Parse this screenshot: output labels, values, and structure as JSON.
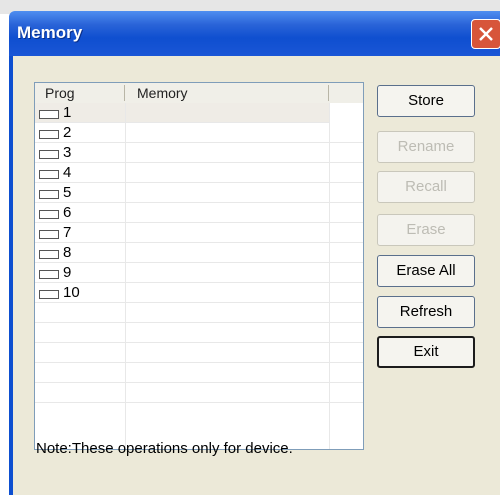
{
  "window": {
    "title": "Memory"
  },
  "list": {
    "columns": [
      "Prog",
      "Memory"
    ],
    "rows": [
      "1",
      "2",
      "3",
      "4",
      "5",
      "6",
      "7",
      "8",
      "9",
      "10"
    ]
  },
  "buttons": {
    "store": "Store",
    "rename": "Rename",
    "recall": "Recall",
    "erase": "Erase",
    "erase_all": "Erase All",
    "refresh": "Refresh",
    "exit": "Exit"
  },
  "note": "Note:These operations only for device.",
  "colors": {
    "titlebar": "#0f4fd0",
    "close": "#d7553a",
    "face": "#ece9d8",
    "disabled_text": "#bdbcb4"
  }
}
